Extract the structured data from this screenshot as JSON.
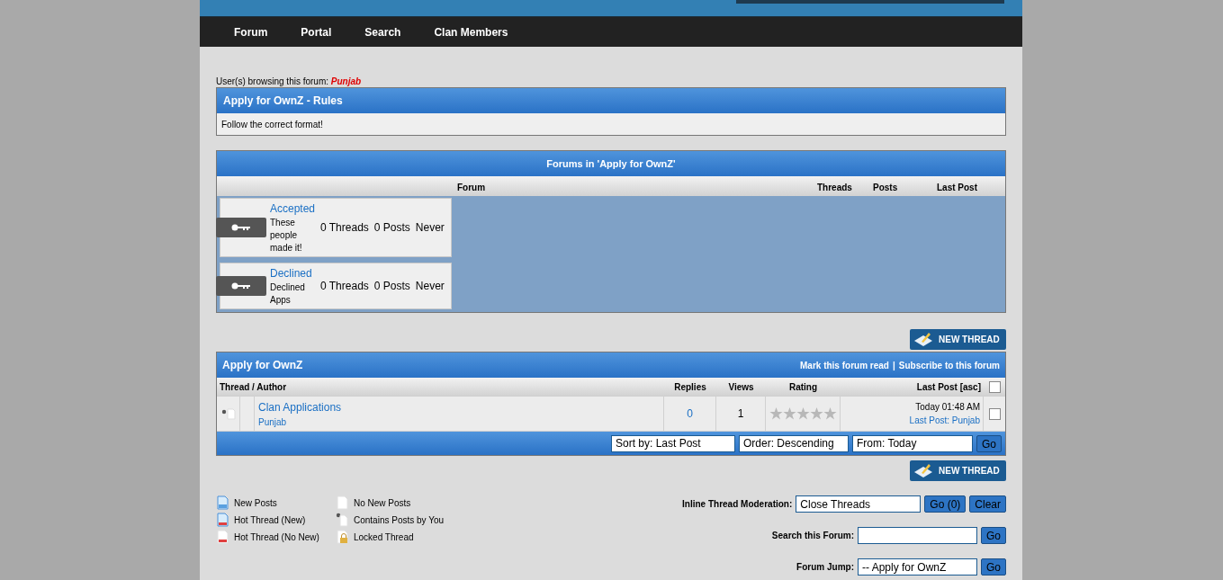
{
  "nav": [
    "Forum",
    "Portal",
    "Search",
    "Clan Members"
  ],
  "browsing": {
    "label": "User(s) browsing this forum:",
    "users": "Punjab"
  },
  "rules": {
    "title": "Apply for OwnZ - Rules",
    "text": "Follow the correct format!"
  },
  "subforums": {
    "title": "Forums in 'Apply for OwnZ'",
    "columns": [
      "Forum",
      "Threads",
      "Posts",
      "Last Post"
    ],
    "rows": [
      {
        "name": "Accepted",
        "description": "These people made it!",
        "threads": "0 Threads",
        "posts": "0 Posts",
        "last_post": "Never"
      },
      {
        "name": "Declined",
        "description": "Declined Apps",
        "threads": "0 Threads",
        "posts": "0 Posts",
        "last_post": "Never"
      }
    ]
  },
  "new_thread_buttons": [
    "NEW THREAD",
    "NEW THREAD"
  ],
  "threads": {
    "title": "Apply for OwnZ",
    "links": [
      "Mark this forum read",
      "Subscribe to this forum"
    ],
    "link_separator": "|",
    "columns": [
      "Thread / Author",
      "Replies",
      "Views",
      "Rating",
      "Last Post [asc]"
    ],
    "select_all": {
      "checked": false
    },
    "rows": [
      {
        "title": "Clan Applications",
        "author": "Punjab",
        "replies": "0",
        "views": "1",
        "stars": 0,
        "last_post_time": "Today 01:48 AM",
        "last_post_by": "Last Post: Punjab",
        "checked": false
      }
    ],
    "sort": {
      "sort_by": "Sort by: Last Post",
      "order": "Order: Descending",
      "from": "From: Today",
      "button": "Go"
    }
  },
  "legend": [
    {
      "kind": "new",
      "label": "New Posts"
    },
    {
      "kind": "plain",
      "label": "No New Posts"
    },
    {
      "kind": "hot-new",
      "label": "Hot Thread (New)"
    },
    {
      "kind": "yours",
      "label": "Contains Posts by You"
    },
    {
      "kind": "hot",
      "label": "Hot Thread (No New)"
    },
    {
      "kind": "locked",
      "label": "Locked Thread"
    }
  ],
  "moderation": {
    "label": "Inline Thread Moderation:",
    "value": "Close Threads",
    "buttons": [
      "Go (0)",
      "Clear"
    ]
  },
  "search": {
    "label": "Search this Forum:",
    "button": "Go"
  },
  "jump": {
    "label": "Forum Jump:",
    "value": "-- Apply for OwnZ",
    "button": "Go"
  }
}
